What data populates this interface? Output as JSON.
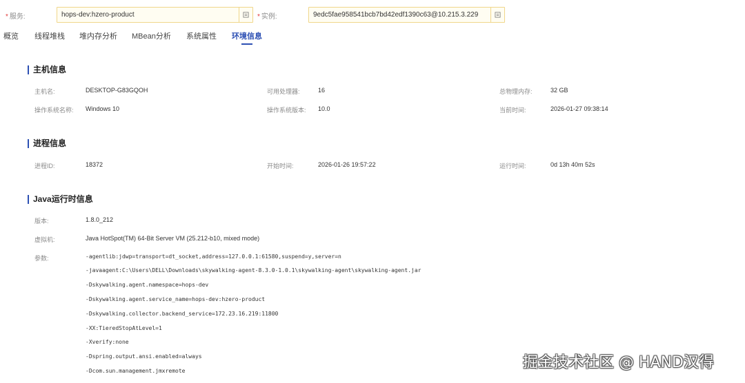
{
  "filters": {
    "service": {
      "label": "服务:",
      "value": "hops-dev:hzero-product"
    },
    "instance": {
      "label": "实例:",
      "value": "9edc5fae958541bcb7bd42edf1390c63@10.215.3.229"
    }
  },
  "tabs": [
    {
      "label": "概览"
    },
    {
      "label": "线程堆栈"
    },
    {
      "label": "堆内存分析"
    },
    {
      "label": "MBean分析"
    },
    {
      "label": "系统属性"
    },
    {
      "label": "环境信息"
    }
  ],
  "host": {
    "title": "主机信息",
    "hostname_label": "主机名:",
    "hostname": "DESKTOP-G83GQOH",
    "cpus_label": "可用处理器:",
    "cpus": "16",
    "mem_label": "总物理内存:",
    "mem": "32 GB",
    "os_label": "操作系统名称:",
    "os": "Windows 10",
    "osver_label": "操作系统版本:",
    "osver": "10.0",
    "time_label": "当前时间:",
    "time": "2026-01-27 09:38:14"
  },
  "process": {
    "title": "进程信息",
    "pid_label": "进程ID:",
    "pid": "18372",
    "start_label": "开始时间:",
    "start": "2026-01-26 19:57:22",
    "uptime_label": "运行时间:",
    "uptime": "0d 13h 40m 52s"
  },
  "java": {
    "title": "Java运行时信息",
    "version_label": "版本:",
    "version": "1.8.0_212",
    "vm_label": "虚拟机:",
    "vm": "Java HotSpot(TM) 64-Bit Server VM (25.212-b10, mixed mode)",
    "args_label": "参数:",
    "args": [
      "-agentlib:jdwp=transport=dt_socket,address=127.0.0.1:61580,suspend=y,server=n",
      "-javaagent:C:\\Users\\DELL\\Downloads\\skywalking-agent-8.3.0-1.0.1\\skywalking-agent\\skywalking-agent.jar",
      "-Dskywalking.agent.namespace=hops-dev",
      "-Dskywalking.agent.service_name=hops-dev:hzero-product",
      "-Dskywalking.collector.backend_service=172.23.16.219:11800",
      "-XX:TieredStopAtLevel=1",
      "-Xverify:none",
      "-Dspring.output.ansi.enabled=always",
      "-Dcom.sun.management.jmxremote"
    ]
  },
  "watermark": "掘金技术社区 @ HAND汉得"
}
